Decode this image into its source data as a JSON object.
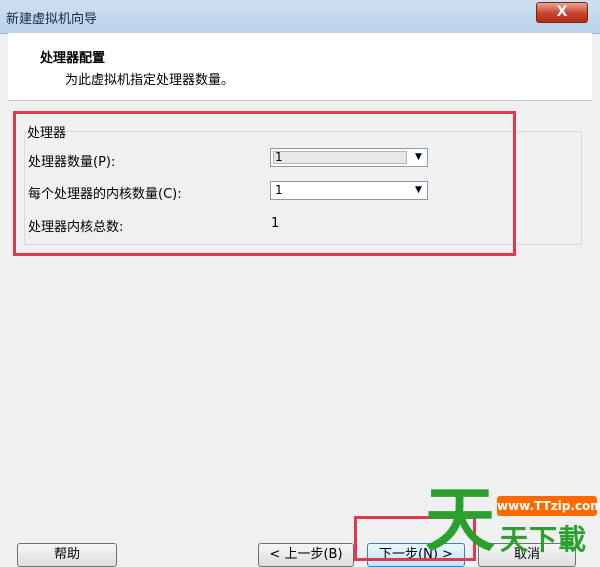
{
  "window": {
    "title": "新建虚拟机向导",
    "close_glyph": "X"
  },
  "header": {
    "title": "处理器配置",
    "subtitle": "为此虚拟机指定处理器数量。"
  },
  "processor_group": {
    "label": "处理器",
    "processor_count_label": "处理器数量(P):",
    "processor_count_value": "1",
    "cores_per_processor_label": "每个处理器的内核数量(C):",
    "cores_per_processor_value": "1",
    "total_cores_label": "处理器内核总数:",
    "total_cores_value": "1"
  },
  "buttons": {
    "help": "帮助",
    "back": "< 上一步(B)",
    "next": "下一步(N) >",
    "cancel": "取消"
  },
  "watermark": {
    "glyph": "天",
    "url": "www.TTzip.com",
    "text": "天下載"
  },
  "colors": {
    "highlight": "#e03a4c",
    "watermark_green": "#2aa12f",
    "watermark_orange": "#ff6a00"
  }
}
